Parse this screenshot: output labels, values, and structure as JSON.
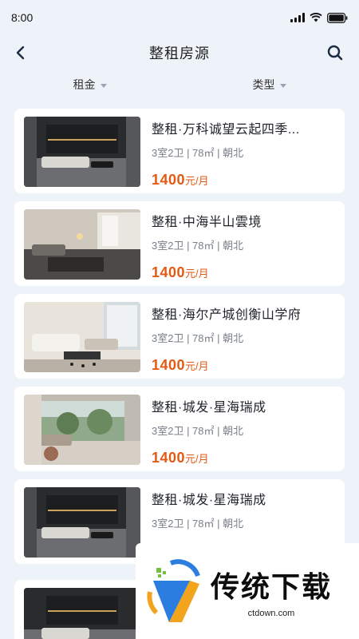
{
  "status_bar": {
    "time": "8:00"
  },
  "nav": {
    "title": "整租房源"
  },
  "filters": [
    {
      "label": "租金"
    },
    {
      "label": "类型"
    }
  ],
  "listings": [
    {
      "title": "整租·万科诚望云起四季...",
      "meta": "3室2卫 | 78㎡ | 朝北",
      "price": "1400",
      "unit": "元/月"
    },
    {
      "title": "整租·中海半山雲境",
      "meta": "3室2卫 | 78㎡ | 朝北",
      "price": "1400",
      "unit": "元/月"
    },
    {
      "title": "整租·海尔产城创衡山学府",
      "meta": "3室2卫 | 78㎡ | 朝北",
      "price": "1400",
      "unit": "元/月"
    },
    {
      "title": "整租·城发·星海瑞成",
      "meta": "3室2卫 | 78㎡ | 朝北",
      "price": "1400",
      "unit": "元/月"
    },
    {
      "title": "整租·城发·星海瑞成",
      "meta": "3室2卫 | 78㎡ | 朝北"
    }
  ],
  "watermark": {
    "brand": "传统下载",
    "url": "ctdown.com"
  },
  "colors": {
    "price": "#e25a13",
    "background": "#eef2f9",
    "card": "#ffffff"
  }
}
